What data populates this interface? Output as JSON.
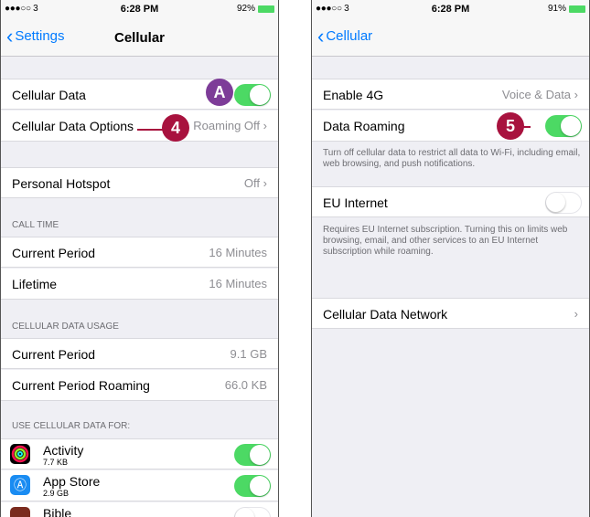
{
  "left": {
    "status": {
      "carrier": "●●●○○ 3",
      "time": "6:28 PM",
      "battery": "92%"
    },
    "back_label": "Settings",
    "title": "Cellular",
    "cellular_data": {
      "label": "Cellular Data",
      "on": true
    },
    "cellular_data_options": {
      "label": "Cellular Data Options",
      "value": "Roaming Off"
    },
    "hotspot": {
      "label": "Personal Hotspot",
      "value": "Off"
    },
    "call_time": {
      "header": "CALL TIME",
      "current_label": "Current Period",
      "current_value": "16 Minutes",
      "lifetime_label": "Lifetime",
      "lifetime_value": "16 Minutes"
    },
    "usage": {
      "header": "CELLULAR DATA USAGE",
      "current_label": "Current Period",
      "current_value": "9.1 GB",
      "roaming_label": "Current Period Roaming",
      "roaming_value": "66.0 KB"
    },
    "apps_header": "USE CELLULAR DATA FOR:",
    "apps": [
      {
        "name": "Activity",
        "size": "7.7 KB",
        "on": true,
        "icon": "activity-icon"
      },
      {
        "name": "App Store",
        "size": "2.9 GB",
        "on": true,
        "icon": "app-store-icon"
      },
      {
        "name": "Bible",
        "size": "",
        "on": false,
        "icon": "bible-icon"
      }
    ]
  },
  "right": {
    "status": {
      "carrier": "●●●○○ 3",
      "time": "6:28 PM",
      "battery": "91%"
    },
    "back_label": "Cellular",
    "enable_4g": {
      "label": "Enable 4G",
      "value": "Voice & Data"
    },
    "data_roaming": {
      "label": "Data Roaming",
      "on": true
    },
    "roaming_footer": "Turn off cellular data to restrict all data to Wi-Fi, including email, web browsing, and push notifications.",
    "eu_internet": {
      "label": "EU Internet",
      "on": false
    },
    "eu_footer": "Requires EU Internet subscription. Turning this on limits web browsing, email, and other services to an EU Internet subscription while roaming.",
    "network": {
      "label": "Cellular Data Network"
    }
  },
  "callouts": {
    "a": "A",
    "four": "4",
    "five": "5"
  },
  "colors": {
    "accent": "#007aff",
    "toggle_on": "#4cd964",
    "callout": "#a8123e",
    "callout_a": "#7d3c98"
  }
}
